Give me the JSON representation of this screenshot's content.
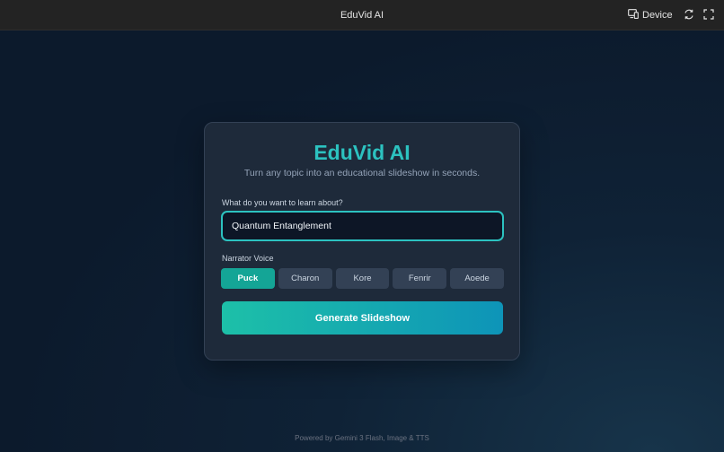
{
  "topbar": {
    "title": "EduVid AI",
    "device_label": "Device",
    "icons": [
      "device-icon",
      "rotate-icon",
      "fullscreen-icon"
    ]
  },
  "card": {
    "title": "EduVid AI",
    "subtitle": "Turn any topic into an educational slideshow in seconds.",
    "topic_label": "What do you want to learn about?",
    "topic_value": "Quantum Entanglement",
    "voice_label": "Narrator Voice",
    "voices": [
      {
        "label": "Puck",
        "selected": true
      },
      {
        "label": "Charon",
        "selected": false
      },
      {
        "label": "Kore",
        "selected": false
      },
      {
        "label": "Fenrir",
        "selected": false
      },
      {
        "label": "Aoede",
        "selected": false
      }
    ],
    "generate_label": "Generate Slideshow"
  },
  "footer": {
    "text": "Powered by Gemini 3 Flash, Image & TTS"
  },
  "colors": {
    "accent": "#2cc2c0",
    "selected_voice": "#14a596",
    "button_gradient_start": "#1dc0a8",
    "button_gradient_end": "#0e94b8",
    "card_bg": "#1e2a3a",
    "topbar_bg": "#232323"
  }
}
